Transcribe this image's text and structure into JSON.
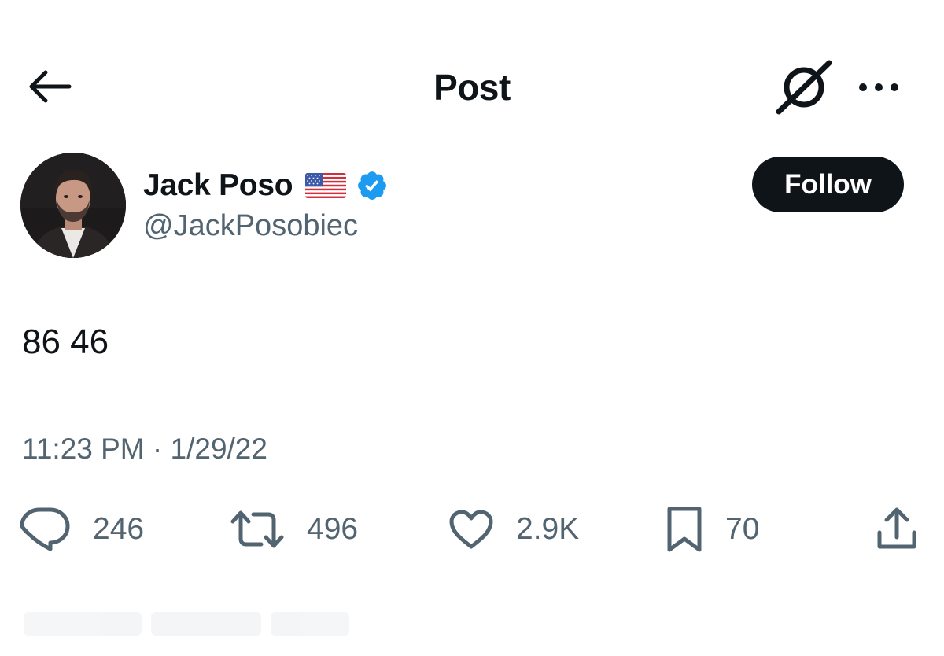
{
  "header": {
    "title": "Post",
    "back_icon": "arrow-left-icon",
    "grok_icon": "grok-icon",
    "more_icon": "more-horizontal-icon"
  },
  "author": {
    "display_name": "Jack Poso",
    "flag_emoji": "🇺🇸",
    "verified": true,
    "handle": "@JackPosobiec",
    "follow_label": "Follow"
  },
  "post": {
    "text": "86 46",
    "time": "11:23 PM",
    "separator": " · ",
    "date": "1/29/22"
  },
  "actions": {
    "replies": "246",
    "reposts": "496",
    "likes": "2.9K",
    "bookmarks": "70",
    "icons": [
      "reply-icon",
      "repost-icon",
      "like-icon",
      "bookmark-icon",
      "share-icon"
    ]
  },
  "colors": {
    "text": "#0f1419",
    "secondary": "#536471",
    "verified_blue": "#1d9bf0",
    "button_bg": "#0f1419"
  }
}
